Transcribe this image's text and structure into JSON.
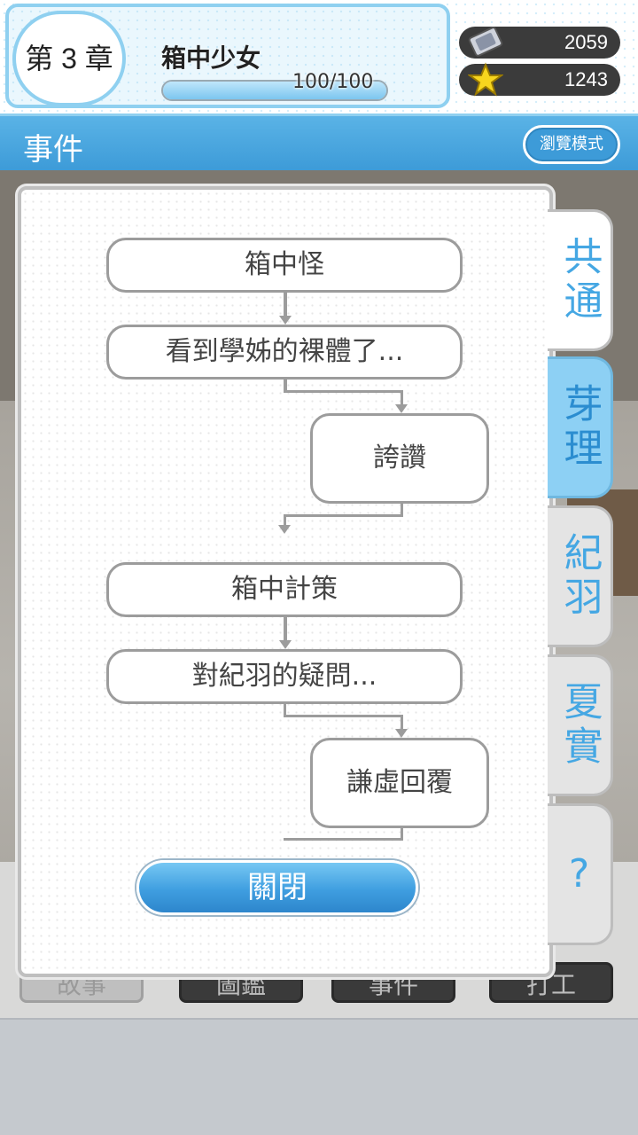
{
  "header": {
    "chapter_label": "第 3 章",
    "chapter_title": "箱中少女",
    "progress_text": "100/100",
    "progress_fraction": 1.0,
    "currency_gems": "2059",
    "currency_stars": "1243"
  },
  "section": {
    "title": "事件",
    "browse_mode_label": "瀏覽模式"
  },
  "events": [
    "箱中怪",
    "看到學姊的裸體了...",
    "誇讚",
    "箱中計策",
    "對紀羽的疑問...",
    "謙虛回覆"
  ],
  "modal": {
    "close_label": "關閉"
  },
  "tabs": [
    {
      "label": "共通",
      "state": "normal"
    },
    {
      "label": "芽理",
      "state": "active"
    },
    {
      "label": "紀羽",
      "state": "normal"
    },
    {
      "label": "夏實",
      "state": "normal"
    },
    {
      "label": "?",
      "state": "normal"
    }
  ],
  "bottom_nav": [
    "故事",
    "圖鑑",
    "事件",
    "打工"
  ],
  "colors": {
    "accent": "#3d9bd8",
    "tab_text": "#45a7e3",
    "active_tab": "#8dd0f4"
  }
}
